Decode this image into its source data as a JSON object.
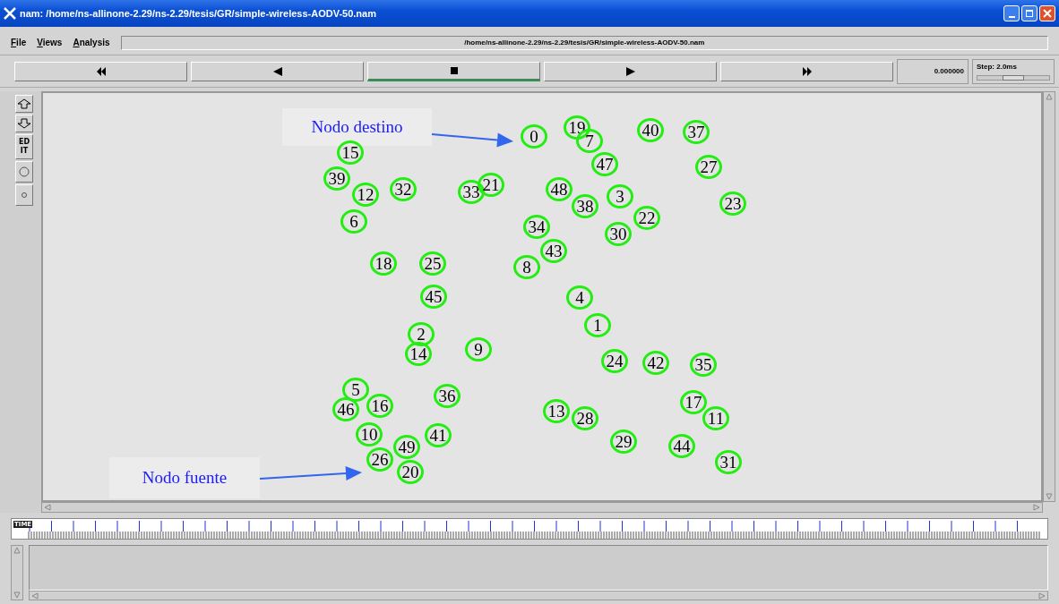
{
  "window": {
    "title": "nam: /home/ns-allinone-2.29/ns-2.29/tesis/GR/simple-wireless-AODV-50.nam"
  },
  "menu": [
    {
      "label": "File"
    },
    {
      "label": "Views"
    },
    {
      "label": "Analysis"
    }
  ],
  "file_path": "/home/ns-allinone-2.29/ns-2.29/tesis/GR/simple-wireless-AODV-50.nam",
  "playback": [
    {
      "kind": "fast-rewind",
      "selected": false
    },
    {
      "kind": "rewind",
      "selected": false
    },
    {
      "kind": "stop",
      "selected": true
    },
    {
      "kind": "play",
      "selected": false
    },
    {
      "kind": "fast-forward",
      "selected": false
    }
  ],
  "time": "0.000000",
  "step": {
    "label": "Step: 2.0ms",
    "level": 0.5
  },
  "tools": [
    {
      "kind": "zoom-in"
    },
    {
      "kind": "zoom-out"
    },
    {
      "kind": "edit",
      "label": "EDIT"
    },
    {
      "kind": "circle-large"
    },
    {
      "kind": "circle-small"
    }
  ],
  "nodes": [
    "0",
    "19",
    "7",
    "40",
    "37",
    "15",
    "47",
    "27",
    "39",
    "12",
    "32",
    "33",
    "21",
    "48",
    "38",
    "3",
    "23",
    "6",
    "34",
    "30",
    "22",
    "43",
    "18",
    "25",
    "8",
    "45",
    "4",
    "2",
    "1",
    "14",
    "9",
    "24",
    "42",
    "35",
    "5",
    "36",
    "46",
    "16",
    "13",
    "28",
    "17",
    "11",
    "10",
    "41",
    "49",
    "29",
    "44",
    "26",
    "20",
    "31"
  ],
  "annotations": [
    {
      "label": "Nodo destino"
    },
    {
      "label": "Nodo fuente"
    }
  ],
  "timeline": {
    "label": "TIME"
  }
}
